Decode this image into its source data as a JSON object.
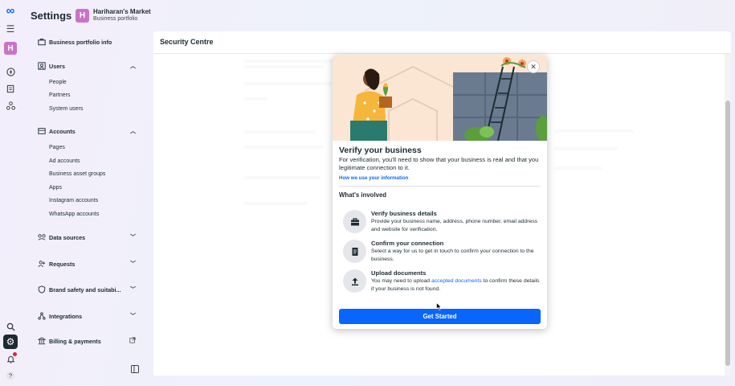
{
  "app": {
    "settings_title": "Settings",
    "business_initial": "H",
    "business_name": "Hariharan's Market",
    "business_subtitle": "Business portfolio"
  },
  "rail": {
    "avatar_initial": "H",
    "icons": [
      "meta-logo-icon",
      "menu-icon",
      "compass-icon",
      "pages-icon",
      "network-icon",
      "search-icon",
      "gear-icon",
      "bell-icon",
      "help-icon"
    ]
  },
  "sidebar": {
    "portfolio_info": "Business portfolio info",
    "users": "Users",
    "users_items": [
      "People",
      "Partners",
      "System users"
    ],
    "accounts": "Accounts",
    "accounts_items": [
      "Pages",
      "Ad accounts",
      "Business asset groups",
      "Apps",
      "Instagram accounts",
      "WhatsApp accounts"
    ],
    "data_sources": "Data sources",
    "requests": "Requests",
    "brand_safety": "Brand safety and suitabi...",
    "integrations": "Integrations",
    "billing": "Billing & payments"
  },
  "main": {
    "title": "Security Centre"
  },
  "modal": {
    "title": "Verify your business",
    "description": "For verification, you'll need to show that your business is real and that you legitimate connection to it.",
    "link": "How we use your information",
    "section_title": "What's involved",
    "steps": [
      {
        "title": "Verify business details",
        "desc": "Provide your business name, address, phone number, email address and website for verification."
      },
      {
        "title": "Confirm your connection",
        "desc": "Select a way for us to get in touch to confirm your connection to the business."
      },
      {
        "title": "Upload documents",
        "desc_pre": "You may need to upload",
        "desc_link": "accepted documents",
        "desc_post": "to confirm these details if your business is not found."
      }
    ],
    "cta": "Get Started"
  },
  "colors": {
    "accent": "#0866ff",
    "avatar": "#c873c8",
    "hero_bg": "#fbe6d4"
  }
}
